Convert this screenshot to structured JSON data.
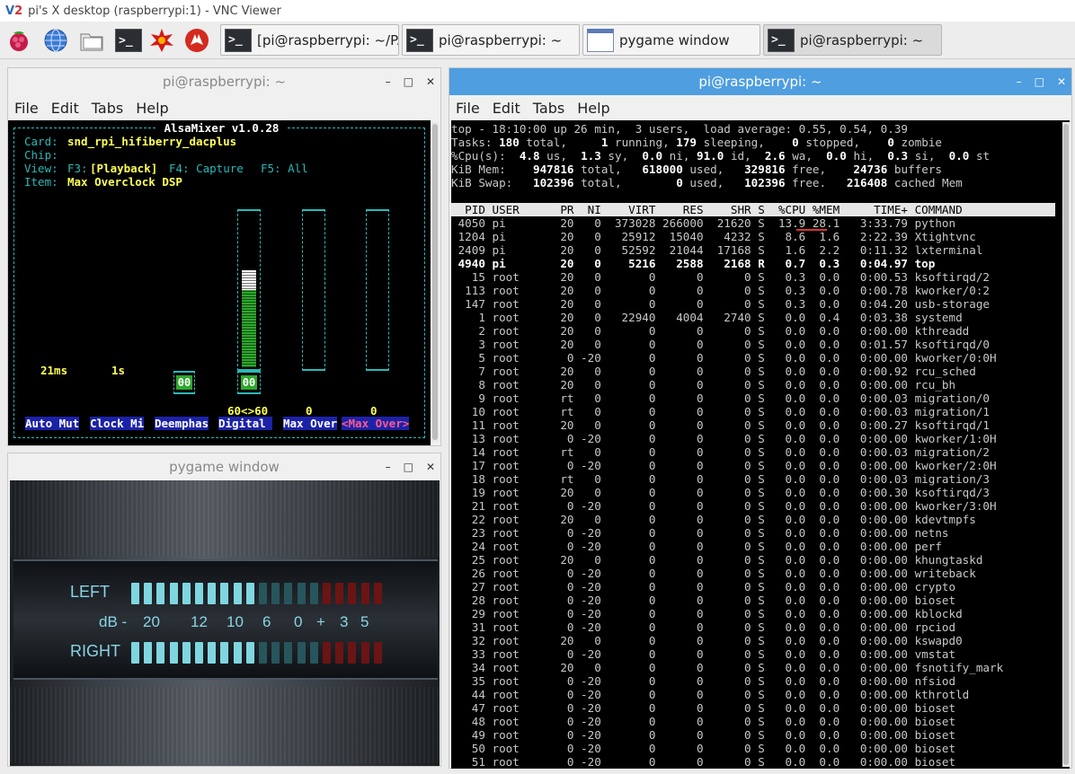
{
  "vnc": {
    "logo_v": "V",
    "logo_2": "2",
    "title": "pi's X desktop (raspberrypi:1) - VNC Viewer"
  },
  "taskbar": {
    "launchers": [
      "raspberry-menu",
      "web-browser",
      "file-manager",
      "terminal",
      "math-app",
      "wolfram-app"
    ],
    "tasks": [
      {
        "label": "[pi@raspberrypi: ~/P...",
        "icon": "terminal-icon"
      },
      {
        "label": "pi@raspberrypi: ~",
        "icon": "terminal-icon"
      },
      {
        "label": "pygame window",
        "icon": "window-icon"
      },
      {
        "label": "pi@raspberrypi: ~",
        "icon": "terminal-icon"
      }
    ],
    "term_glyph": ">_"
  },
  "alsa_window": {
    "title": "pi@raspberrypi: ~",
    "menu": [
      "File",
      "Edit",
      "Tabs",
      "Help"
    ],
    "controls": {
      "minimize": "–",
      "maximize": "□",
      "close": "✕"
    },
    "mixer": {
      "header": " AlsaMixer v1.0.28 ",
      "card_label": "Card:",
      "card_value": "snd_rpi_hifiberry_dacplus",
      "chip_label": "Chip:",
      "view_label": "View:",
      "view_f3": "F3:",
      "view_playback": "[Playback]",
      "view_f4": "F4: Capture",
      "view_f5": "F5: All",
      "item_label": "Item:",
      "item_value": "Max Overclock DSP",
      "v_21ms": "21ms",
      "v_1s": "1s",
      "digital_value": "60<>60",
      "val_a": "0",
      "val_b": "0",
      "mute_a": "00",
      "mute_b": "00",
      "digital_level": 0.62,
      "labels": [
        "Auto Mut",
        "Clock Mi",
        "Deemphas",
        "Digital ",
        "Max Over"
      ],
      "selected_label": "<Max Over>"
    }
  },
  "pygame_window": {
    "title": "pygame window",
    "controls": {
      "minimize": "–",
      "maximize": "□",
      "close": "✕"
    },
    "vu": {
      "left": "LEFT",
      "right": "RIGHT",
      "scale": [
        "dB -",
        "20",
        "12",
        "10",
        "6",
        "0",
        "+",
        "3",
        "5"
      ],
      "colors": {
        "on": "#7fd6e0",
        "dim": "#27555c",
        "red": "#6b1414"
      }
    }
  },
  "top_window": {
    "title": "pi@raspberrypi: ~",
    "menu": [
      "File",
      "Edit",
      "Tabs",
      "Help"
    ],
    "controls": {
      "minimize": "–",
      "maximize": "□",
      "close": "✕"
    },
    "summary": [
      [
        "top - 18:10:00 up 26 min,  3 users,  load average: 0.55, 0.54, 0.39"
      ],
      [
        "Tasks:",
        [
          " 180",
          "b"
        ],
        [
          " total,     ",
          ""
        ],
        [
          "1",
          "b"
        ],
        [
          " running, ",
          ""
        ],
        [
          "179",
          "b"
        ],
        [
          " sleeping,    ",
          ""
        ],
        [
          "0",
          "b"
        ],
        [
          " stopped,    ",
          ""
        ],
        [
          "0",
          "b"
        ],
        [
          " zombie",
          ""
        ]
      ],
      [
        "%Cpu(s):",
        [
          "  4.8",
          "b"
        ],
        [
          " us,  ",
          ""
        ],
        [
          "1.3",
          "b"
        ],
        [
          " sy,  ",
          ""
        ],
        [
          "0.0",
          "b"
        ],
        [
          " ni, ",
          ""
        ],
        [
          "91.0",
          "b"
        ],
        [
          " id,  ",
          ""
        ],
        [
          "2.6",
          "b"
        ],
        [
          " wa,  ",
          ""
        ],
        [
          "0.0",
          "b"
        ],
        [
          " hi,  ",
          ""
        ],
        [
          "0.3",
          "b"
        ],
        [
          " si,  ",
          ""
        ],
        [
          "0.0",
          "b"
        ],
        [
          " st",
          ""
        ]
      ],
      [
        "KiB Mem: ",
        [
          "   947816",
          "b"
        ],
        [
          " total,   ",
          ""
        ],
        [
          "618000",
          "b"
        ],
        [
          " used,   ",
          ""
        ],
        [
          "329816",
          "b"
        ],
        [
          " free,    ",
          ""
        ],
        [
          "24736",
          "b"
        ],
        [
          " buffers",
          ""
        ]
      ],
      [
        "KiB Swap:",
        [
          "   102396",
          "b"
        ],
        [
          " total,        ",
          ""
        ],
        [
          "0",
          "b"
        ],
        [
          " used,   ",
          ""
        ],
        [
          "102396",
          "b"
        ],
        [
          " free.   ",
          ""
        ],
        [
          "216408",
          "b"
        ],
        [
          " cached Mem",
          ""
        ]
      ]
    ],
    "header": "  PID USER      PR  NI    VIRT    RES    SHR S  %CPU %MEM     TIME+ COMMAND                 ",
    "highlight_color": "#e03030",
    "processes": [
      [
        "4050",
        "pi",
        "20",
        "0",
        "373028",
        "266000",
        "21620",
        "S",
        "13.9",
        "28.1",
        "3:33.79",
        "python"
      ],
      [
        "1204",
        "pi",
        "20",
        "0",
        "25912",
        "15040",
        "4232",
        "S",
        "8.6",
        "1.6",
        "2:22.39",
        "Xtightvnc"
      ],
      [
        "2409",
        "pi",
        "20",
        "0",
        "52592",
        "21044",
        "17168",
        "S",
        "1.6",
        "2.2",
        "0:11.32",
        "lxterminal"
      ],
      [
        "4940",
        "pi",
        "20",
        "0",
        "5216",
        "2588",
        "2168",
        "R",
        "0.7",
        "0.3",
        "0:04.97",
        "top"
      ],
      [
        "15",
        "root",
        "20",
        "0",
        "0",
        "0",
        "0",
        "S",
        "0.3",
        "0.0",
        "0:00.53",
        "ksoftirqd/2"
      ],
      [
        "113",
        "root",
        "20",
        "0",
        "0",
        "0",
        "0",
        "S",
        "0.3",
        "0.0",
        "0:00.78",
        "kworker/0:2"
      ],
      [
        "147",
        "root",
        "20",
        "0",
        "0",
        "0",
        "0",
        "S",
        "0.3",
        "0.0",
        "0:04.20",
        "usb-storage"
      ],
      [
        "1",
        "root",
        "20",
        "0",
        "22940",
        "4004",
        "2740",
        "S",
        "0.0",
        "0.4",
        "0:03.38",
        "systemd"
      ],
      [
        "2",
        "root",
        "20",
        "0",
        "0",
        "0",
        "0",
        "S",
        "0.0",
        "0.0",
        "0:00.00",
        "kthreadd"
      ],
      [
        "3",
        "root",
        "20",
        "0",
        "0",
        "0",
        "0",
        "S",
        "0.0",
        "0.0",
        "0:01.57",
        "ksoftirqd/0"
      ],
      [
        "5",
        "root",
        "0",
        "-20",
        "0",
        "0",
        "0",
        "S",
        "0.0",
        "0.0",
        "0:00.00",
        "kworker/0:0H"
      ],
      [
        "7",
        "root",
        "20",
        "0",
        "0",
        "0",
        "0",
        "S",
        "0.0",
        "0.0",
        "0:00.92",
        "rcu_sched"
      ],
      [
        "8",
        "root",
        "20",
        "0",
        "0",
        "0",
        "0",
        "S",
        "0.0",
        "0.0",
        "0:00.00",
        "rcu_bh"
      ],
      [
        "9",
        "root",
        "rt",
        "0",
        "0",
        "0",
        "0",
        "S",
        "0.0",
        "0.0",
        "0:00.03",
        "migration/0"
      ],
      [
        "10",
        "root",
        "rt",
        "0",
        "0",
        "0",
        "0",
        "S",
        "0.0",
        "0.0",
        "0:00.03",
        "migration/1"
      ],
      [
        "11",
        "root",
        "20",
        "0",
        "0",
        "0",
        "0",
        "S",
        "0.0",
        "0.0",
        "0:00.27",
        "ksoftirqd/1"
      ],
      [
        "13",
        "root",
        "0",
        "-20",
        "0",
        "0",
        "0",
        "S",
        "0.0",
        "0.0",
        "0:00.00",
        "kworker/1:0H"
      ],
      [
        "14",
        "root",
        "rt",
        "0",
        "0",
        "0",
        "0",
        "S",
        "0.0",
        "0.0",
        "0:00.03",
        "migration/2"
      ],
      [
        "17",
        "root",
        "0",
        "-20",
        "0",
        "0",
        "0",
        "S",
        "0.0",
        "0.0",
        "0:00.00",
        "kworker/2:0H"
      ],
      [
        "18",
        "root",
        "rt",
        "0",
        "0",
        "0",
        "0",
        "S",
        "0.0",
        "0.0",
        "0:00.03",
        "migration/3"
      ],
      [
        "19",
        "root",
        "20",
        "0",
        "0",
        "0",
        "0",
        "S",
        "0.0",
        "0.0",
        "0:00.30",
        "ksoftirqd/3"
      ],
      [
        "21",
        "root",
        "0",
        "-20",
        "0",
        "0",
        "0",
        "S",
        "0.0",
        "0.0",
        "0:00.00",
        "kworker/3:0H"
      ],
      [
        "22",
        "root",
        "20",
        "0",
        "0",
        "0",
        "0",
        "S",
        "0.0",
        "0.0",
        "0:00.00",
        "kdevtmpfs"
      ],
      [
        "23",
        "root",
        "0",
        "-20",
        "0",
        "0",
        "0",
        "S",
        "0.0",
        "0.0",
        "0:00.00",
        "netns"
      ],
      [
        "24",
        "root",
        "0",
        "-20",
        "0",
        "0",
        "0",
        "S",
        "0.0",
        "0.0",
        "0:00.00",
        "perf"
      ],
      [
        "25",
        "root",
        "20",
        "0",
        "0",
        "0",
        "0",
        "S",
        "0.0",
        "0.0",
        "0:00.00",
        "khungtaskd"
      ],
      [
        "26",
        "root",
        "0",
        "-20",
        "0",
        "0",
        "0",
        "S",
        "0.0",
        "0.0",
        "0:00.00",
        "writeback"
      ],
      [
        "27",
        "root",
        "0",
        "-20",
        "0",
        "0",
        "0",
        "S",
        "0.0",
        "0.0",
        "0:00.00",
        "crypto"
      ],
      [
        "28",
        "root",
        "0",
        "-20",
        "0",
        "0",
        "0",
        "S",
        "0.0",
        "0.0",
        "0:00.00",
        "bioset"
      ],
      [
        "29",
        "root",
        "0",
        "-20",
        "0",
        "0",
        "0",
        "S",
        "0.0",
        "0.0",
        "0:00.00",
        "kblockd"
      ],
      [
        "31",
        "root",
        "0",
        "-20",
        "0",
        "0",
        "0",
        "S",
        "0.0",
        "0.0",
        "0:00.00",
        "rpciod"
      ],
      [
        "32",
        "root",
        "20",
        "0",
        "0",
        "0",
        "0",
        "S",
        "0.0",
        "0.0",
        "0:00.00",
        "kswapd0"
      ],
      [
        "33",
        "root",
        "0",
        "-20",
        "0",
        "0",
        "0",
        "S",
        "0.0",
        "0.0",
        "0:00.00",
        "vmstat"
      ],
      [
        "34",
        "root",
        "20",
        "0",
        "0",
        "0",
        "0",
        "S",
        "0.0",
        "0.0",
        "0:00.00",
        "fsnotify_mark"
      ],
      [
        "35",
        "root",
        "0",
        "-20",
        "0",
        "0",
        "0",
        "S",
        "0.0",
        "0.0",
        "0:00.00",
        "nfsiod"
      ],
      [
        "44",
        "root",
        "0",
        "-20",
        "0",
        "0",
        "0",
        "S",
        "0.0",
        "0.0",
        "0:00.00",
        "kthrotld"
      ],
      [
        "47",
        "root",
        "0",
        "-20",
        "0",
        "0",
        "0",
        "S",
        "0.0",
        "0.0",
        "0:00.00",
        "bioset"
      ],
      [
        "48",
        "root",
        "0",
        "-20",
        "0",
        "0",
        "0",
        "S",
        "0.0",
        "0.0",
        "0:00.00",
        "bioset"
      ],
      [
        "49",
        "root",
        "0",
        "-20",
        "0",
        "0",
        "0",
        "S",
        "0.0",
        "0.0",
        "0:00.00",
        "bioset"
      ],
      [
        "50",
        "root",
        "0",
        "-20",
        "0",
        "0",
        "0",
        "S",
        "0.0",
        "0.0",
        "0:00.00",
        "bioset"
      ],
      [
        "51",
        "root",
        "0",
        "-20",
        "0",
        "0",
        "0",
        "S",
        "0.0",
        "0.0",
        "0:00.00",
        "bioset"
      ]
    ],
    "bold_rows": [
      3
    ]
  }
}
